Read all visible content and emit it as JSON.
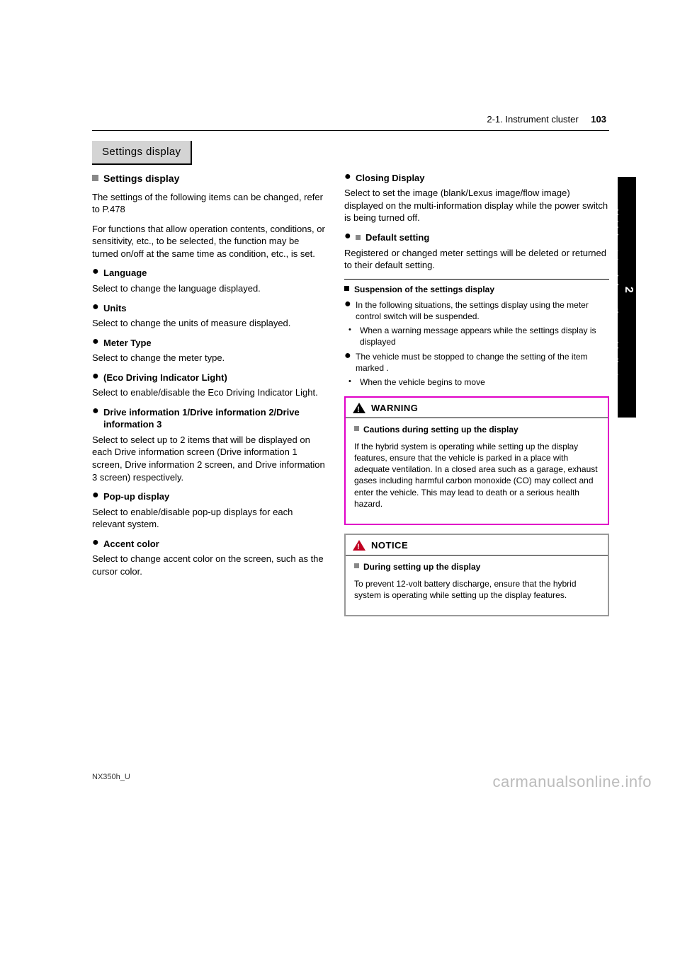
{
  "header": {
    "section": "2-1. Instrument cluster",
    "page": "103"
  },
  "heading": "Settings display",
  "left": {
    "title": "Settings display",
    "p1": "The settings of the following items can be changed, refer to P.478",
    "p2": "For functions that allow operation contents, conditions, or sensitivity, etc., to be selected, the function may be turned on/off at the same time as condition, etc., is set.",
    "b1_label": "Language",
    "b1_text": "Select to change the language displayed.",
    "b2_label": "Units",
    "b2_text": "Select to change the units of measure displayed.",
    "b3_label": "Meter Type",
    "b3_text": "Select to change the meter type.",
    "b4_label": "(Eco Driving Indicator Light)",
    "b4_text": "Select to enable/disable the Eco Driving Indicator Light.",
    "b5_label": "Drive information 1/Drive information 2/Drive information 3",
    "b5_text": "Select to select up to 2 items that will be displayed on each Drive information screen (Drive information 1 screen, Drive information 2 screen, and Drive information 3 screen) respectively.",
    "b6_label": "Pop-up display",
    "b6_text": "Select to enable/disable pop-up displays for each relevant system.",
    "b7_label": "Accent color",
    "b7_text": "Select to change accent color on the screen, such as the cursor color."
  },
  "right": {
    "b8_label": "Closing Display",
    "b8_text": "Select to set the image (blank/Lexus image/flow image) displayed on the multi-information display while the power switch is being turned off.",
    "b9_label": "Default setting",
    "b9_text": "Registered or changed meter settings will be deleted or returned to their default setting.",
    "susp_title": "Suspension of the settings display",
    "susp_b1": "In the following situations, the settings display using the meter control switch will be suspended.",
    "susp_b1a": "When a warning message appears while the settings display is displayed",
    "susp_b2": "The vehicle must be stopped to change the setting of the item marked .",
    "susp_b3": "When the vehicle begins to move"
  },
  "warning": {
    "title": "WARNING",
    "sub": "Cautions during setting up the display",
    "text": "If the hybrid system is operating while setting up the display features, ensure that the vehicle is parked in a place with adequate ventilation. In a closed area such as a garage, exhaust gases including harmful carbon monoxide (CO) may collect and enter the vehicle. This may lead to death or a serious health hazard."
  },
  "notice": {
    "title": "NOTICE",
    "sub": "During setting up the display",
    "text": "To prevent 12-volt battery discharge, ensure that the hybrid system is operating while setting up the display features."
  },
  "sidebar": {
    "num": "2",
    "label": "Vehicle status information and indicators"
  },
  "footer": "NX350h_U",
  "watermark": "carmanualsonline.info"
}
